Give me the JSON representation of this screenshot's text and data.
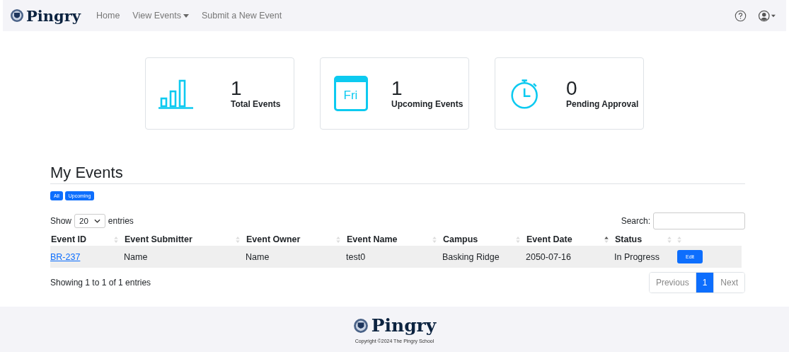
{
  "navbar": {
    "brand": "Pingry",
    "links": [
      {
        "label": "Home",
        "dropdown": false
      },
      {
        "label": "View Events",
        "dropdown": true
      },
      {
        "label": "Submit a New Event",
        "dropdown": false
      }
    ]
  },
  "stats": [
    {
      "kind": "chart",
      "value": "1",
      "label": "Total Events"
    },
    {
      "kind": "calendar",
      "icon_text": "Fri",
      "value": "1",
      "label": "Upcoming Events"
    },
    {
      "kind": "timer",
      "value": "0",
      "label": "Pending Approval"
    }
  ],
  "section_title": "My Events",
  "filters": [
    "All",
    "Upcoming"
  ],
  "length_control": {
    "before": "Show",
    "value": "20",
    "after": "entries"
  },
  "search": {
    "label": "Search:"
  },
  "table": {
    "columns": [
      {
        "label": "Event ID",
        "sorted": false
      },
      {
        "label": "Event Submitter",
        "sorted": false
      },
      {
        "label": "Event Owner",
        "sorted": false
      },
      {
        "label": "Event Name",
        "sorted": false
      },
      {
        "label": "Campus",
        "sorted": false
      },
      {
        "label": "Event Date",
        "sorted": true
      },
      {
        "label": "Status",
        "sorted": false
      },
      {
        "sorted": false
      }
    ],
    "rows": [
      {
        "cells": [
          "BR-237",
          "Name",
          "Name",
          "test0",
          "Basking Ridge",
          "2050-07-16",
          "In Progress"
        ],
        "action": "Edit"
      }
    ]
  },
  "info": "Showing 1 to 1 of 1 entries",
  "pagination": [
    {
      "label": "Previous",
      "selected": false,
      "disabled": true
    },
    {
      "label": "1",
      "selected": true,
      "disabled": false
    },
    {
      "label": "Next",
      "selected": false,
      "disabled": true
    }
  ],
  "footer": {
    "brand": "Pingry",
    "copyright": "Copyright ©2024 The Pingry School"
  }
}
